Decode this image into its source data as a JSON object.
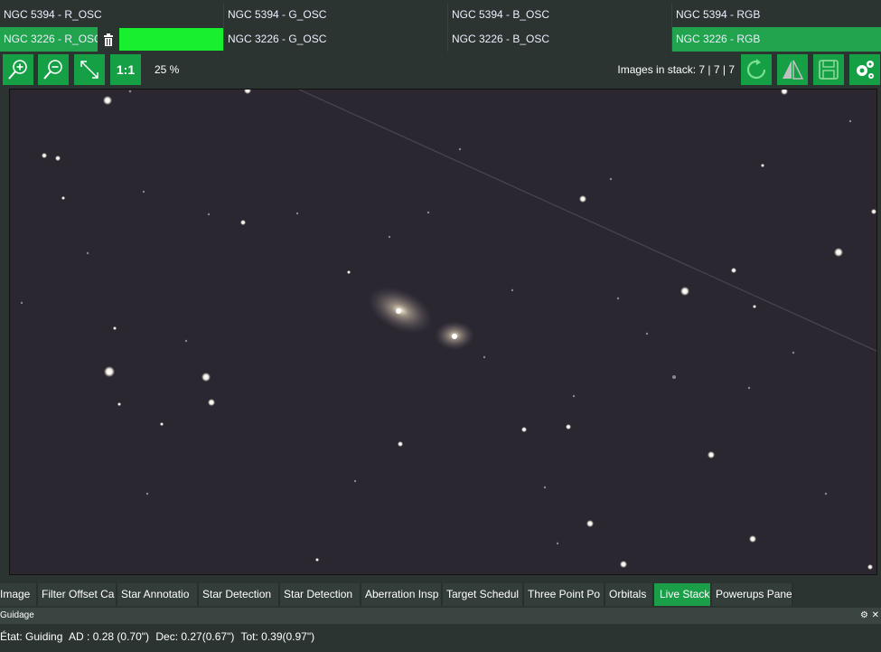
{
  "stack_grid": {
    "row1": [
      "NGC 5394 - R_OSC",
      "NGC 5394 - G_OSC",
      "NGC 5394 - B_OSC",
      "NGC 5394 - RGB"
    ],
    "row2": [
      "NGC 3226 - R_OSC",
      "NGC 3226 - G_OSC",
      "NGC 3226 - B_OSC",
      "NGC 3226 - RGB"
    ]
  },
  "toolbar": {
    "zoom_in": "zoom-in",
    "zoom_out": "zoom-out",
    "fit": "fit-to-window",
    "one_to_one_label": "1:1",
    "zoom_level": "25 %",
    "images_in_stack": "Images in stack: 7 | 7 | 7"
  },
  "tabs": [
    {
      "label": "Image",
      "active": false
    },
    {
      "label": "Filter Offset Ca",
      "active": false
    },
    {
      "label": "Star Annotatio",
      "active": false
    },
    {
      "label": "Star Detection",
      "active": false
    },
    {
      "label": "Star Detection",
      "active": false
    },
    {
      "label": "Aberration Insp",
      "active": false
    },
    {
      "label": "Target Schedul",
      "active": false
    },
    {
      "label": "Three Point Po",
      "active": false
    },
    {
      "label": "Orbitals",
      "active": false
    },
    {
      "label": "Live Stack",
      "active": true
    },
    {
      "label": "Powerups Pane",
      "active": false
    }
  ],
  "guidage": {
    "title": "Guidage"
  },
  "status": {
    "state": "État: Guiding",
    "ad": "AD : 0.28 (0.70\")",
    "dec": "Dec: 0.27(0.67\")",
    "tot": "Tot: 0.39(0.97\")"
  },
  "colors": {
    "accent": "#15a045",
    "bright_green": "#17ef2f",
    "background": "#2b3431",
    "sky": "#2a2630"
  }
}
